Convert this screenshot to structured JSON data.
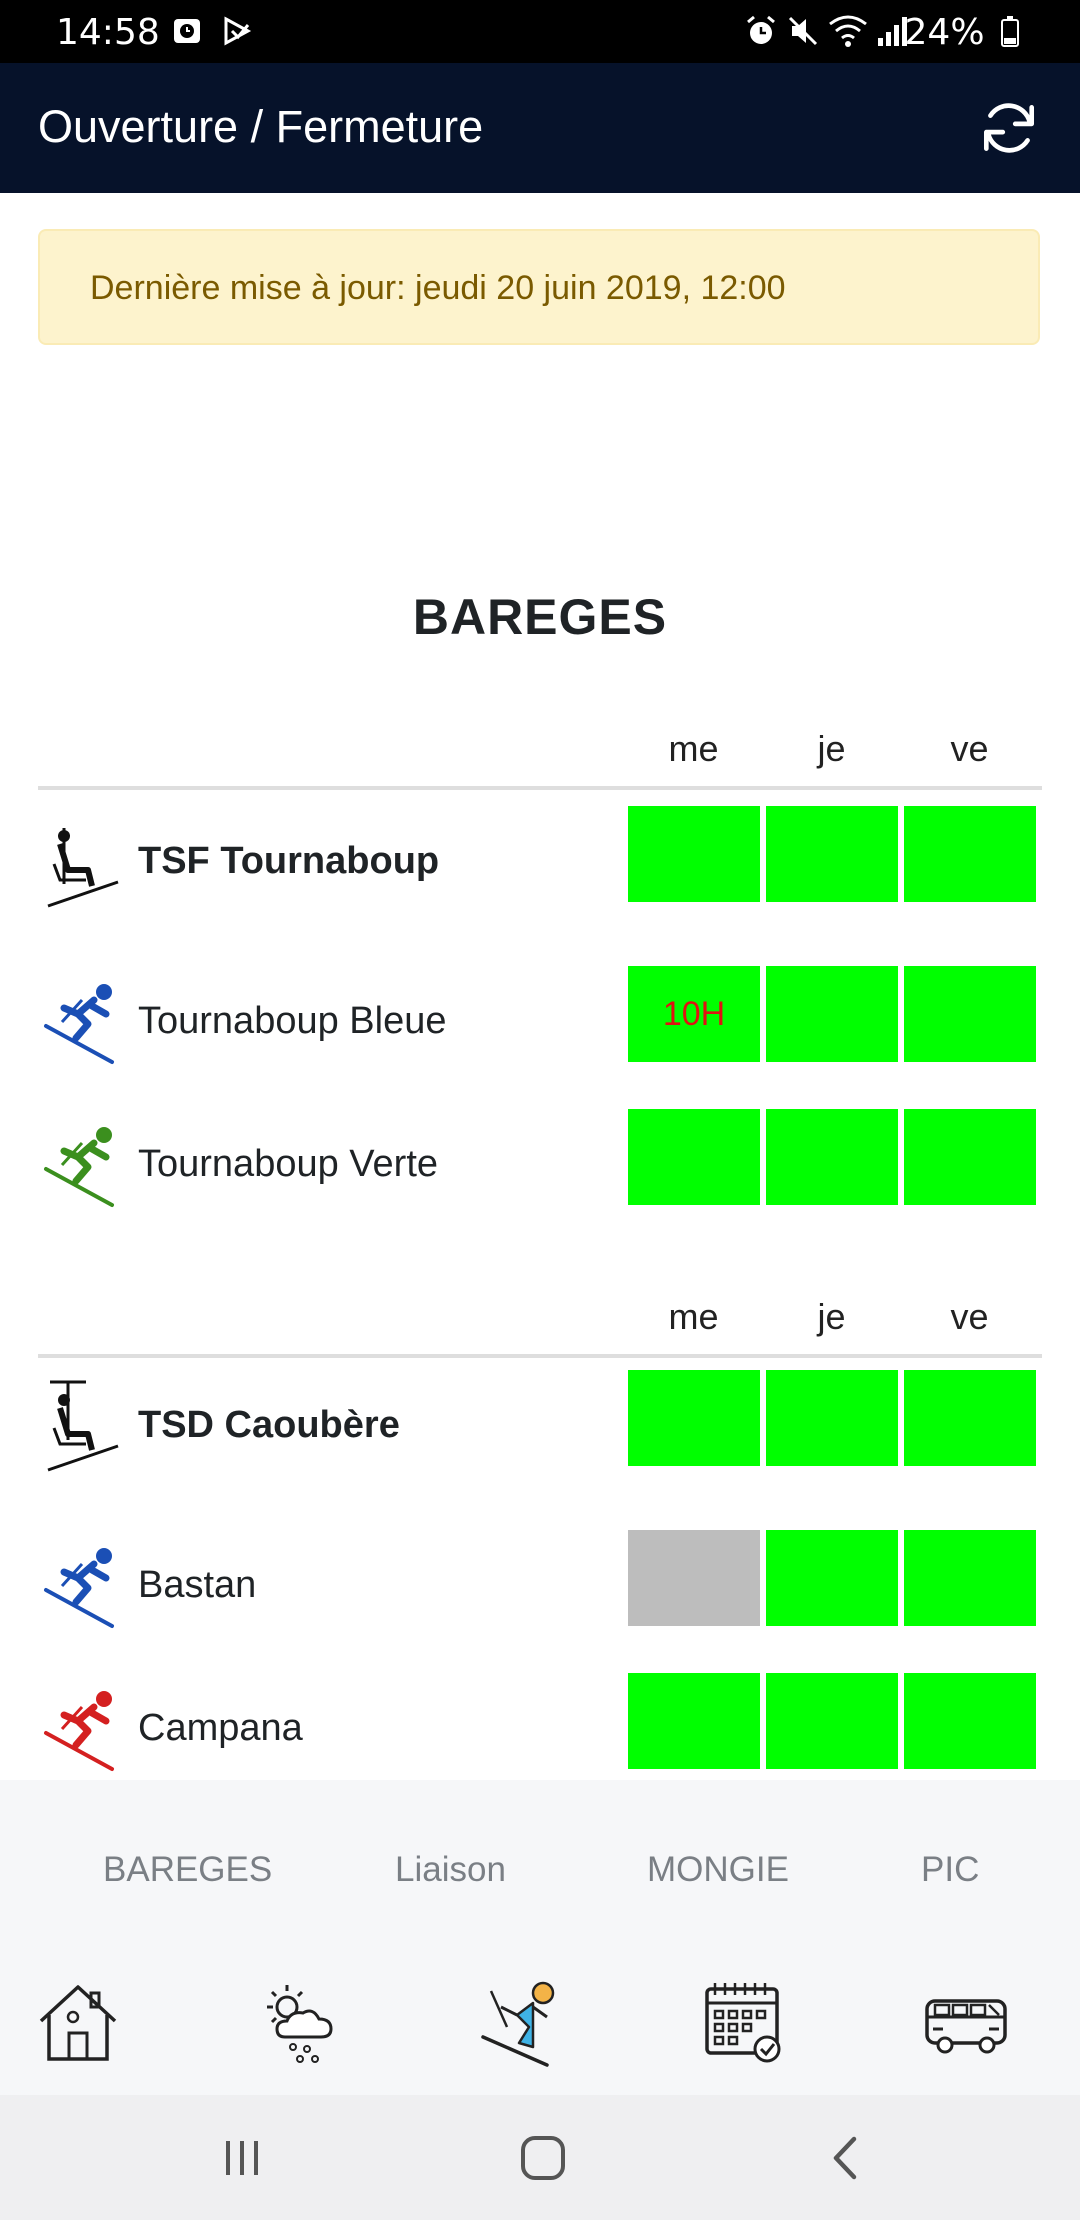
{
  "status_bar": {
    "time": "14:58",
    "battery": "24%"
  },
  "app_bar": {
    "title": "Ouverture / Fermeture",
    "refresh_icon": "refresh-icon"
  },
  "alert": {
    "text": "Dernière mise à jour: jeudi 20 juin 2019, 12:00"
  },
  "resort": {
    "title": "BAREGES"
  },
  "colors": {
    "open": "#00ff00",
    "closed": "#bdbdbd",
    "note": "#e01212",
    "blue_run": "#1b4fb5",
    "green_run": "#3b8f1e",
    "red_run": "#d42020"
  },
  "groups": [
    {
      "days": [
        "me",
        "je",
        "ve"
      ],
      "rows": [
        {
          "name": "TSF Tournaboup",
          "icon": "chairlift-icon",
          "cells": [
            {
              "status": "open",
              "text": ""
            },
            {
              "status": "open",
              "text": ""
            },
            {
              "status": "open",
              "text": ""
            }
          ]
        },
        {
          "name": "Tournaboup Bleue",
          "icon": "skier-blue-icon",
          "cells": [
            {
              "status": "open",
              "text": "10H"
            },
            {
              "status": "open",
              "text": ""
            },
            {
              "status": "open",
              "text": ""
            }
          ]
        },
        {
          "name": "Tournaboup Verte",
          "icon": "skier-green-icon",
          "cells": [
            {
              "status": "open",
              "text": ""
            },
            {
              "status": "open",
              "text": ""
            },
            {
              "status": "open",
              "text": ""
            }
          ]
        }
      ]
    },
    {
      "days": [
        "me",
        "je",
        "ve"
      ],
      "rows": [
        {
          "name": "TSD Caoubère",
          "icon": "chairlift-icon",
          "cells": [
            {
              "status": "open",
              "text": ""
            },
            {
              "status": "open",
              "text": ""
            },
            {
              "status": "open",
              "text": ""
            }
          ]
        },
        {
          "name": "Bastan",
          "icon": "skier-blue-icon",
          "cells": [
            {
              "status": "closed",
              "text": ""
            },
            {
              "status": "open",
              "text": ""
            },
            {
              "status": "open",
              "text": ""
            }
          ]
        },
        {
          "name": "Campana",
          "icon": "skier-red-icon",
          "cells": [
            {
              "status": "open",
              "text": ""
            },
            {
              "status": "open",
              "text": ""
            },
            {
              "status": "open",
              "text": ""
            }
          ]
        }
      ]
    }
  ],
  "tabs": [
    {
      "label": "BAREGES"
    },
    {
      "label": "Liaison"
    },
    {
      "label": "MONGIE"
    },
    {
      "label": "PIC"
    }
  ],
  "bottom_nav": [
    {
      "icon": "home-icon"
    },
    {
      "icon": "weather-icon"
    },
    {
      "icon": "ski-icon"
    },
    {
      "icon": "calendar-icon"
    },
    {
      "icon": "bus-icon"
    }
  ]
}
